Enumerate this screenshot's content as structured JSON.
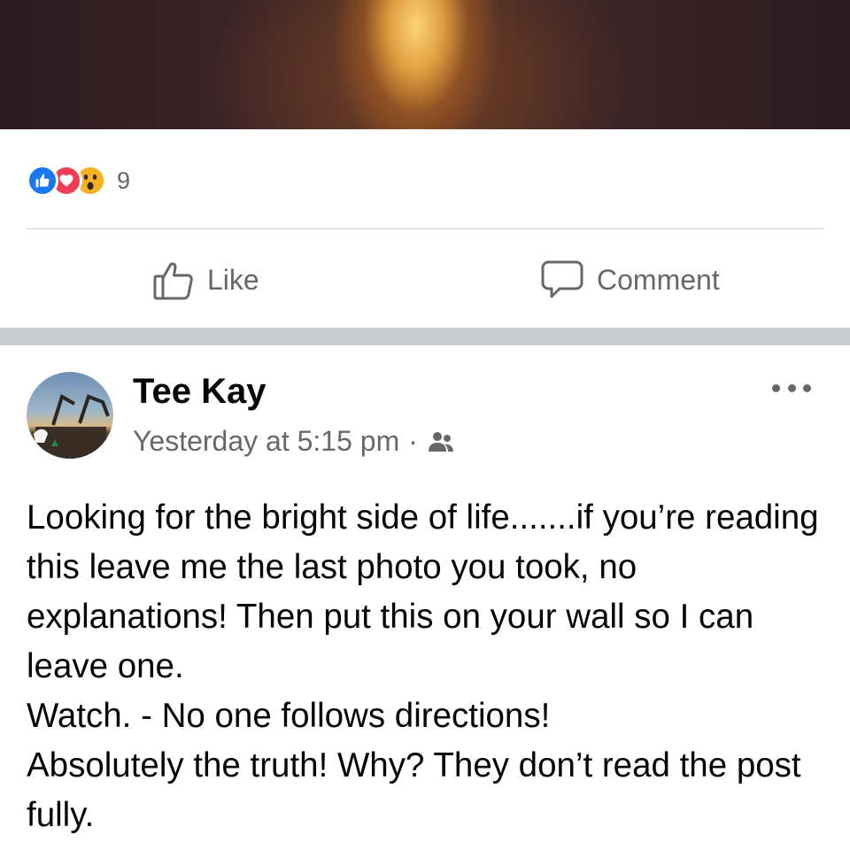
{
  "colors": {
    "like_blue": "#1877f2",
    "love_red": "#f33e58",
    "wow_yellow": "#f7b125",
    "secondary_text": "#65676b",
    "section_separator": "#c9ccd1"
  },
  "previous_post": {
    "reactions": {
      "icons": [
        "like-icon",
        "love-icon",
        "wow-icon"
      ],
      "count": "9"
    },
    "actions": {
      "like_label": "Like",
      "comment_label": "Comment"
    }
  },
  "post": {
    "author": "Tee Kay",
    "timestamp": "Yesterday at 5:15 pm",
    "separator": "·",
    "audience_icon": "friends-icon",
    "more_icon": "more-options-icon",
    "text_lines": [
      "Looking for the bright side of life.......if you’re reading this leave me the last photo you took, no explanations! Then put this on your wall so I can leave one.",
      "Watch. - No one follows directions!",
      "Absolutely the truth! Why? They don’t read the post fully."
    ]
  }
}
